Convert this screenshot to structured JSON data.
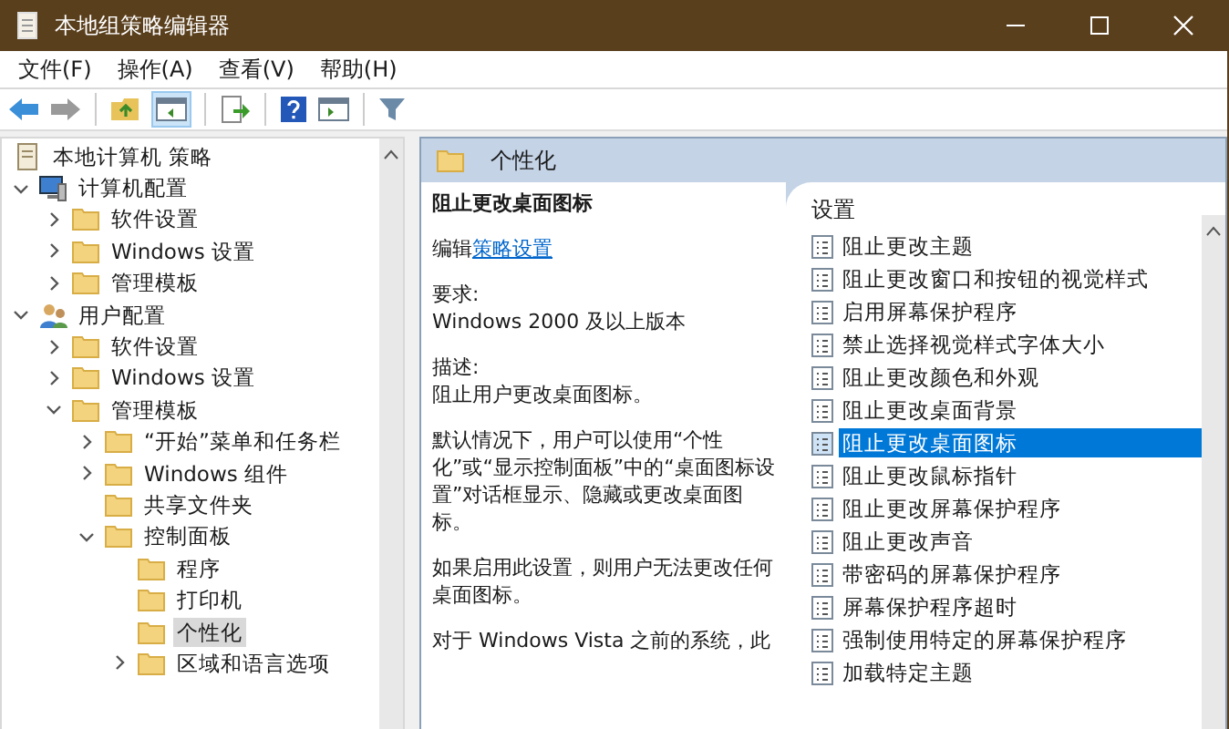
{
  "window": {
    "title": "本地组策略编辑器"
  },
  "menu": [
    "文件(F)",
    "操作(A)",
    "查看(V)",
    "帮助(H)"
  ],
  "tree": [
    {
      "label": "本地计算机 策略",
      "kind": "policy",
      "selected": false,
      "children": [
        {
          "label": "计算机配置",
          "kind": "computer",
          "selected": false,
          "expanded": true,
          "children": [
            {
              "label": "软件设置",
              "kind": "folder",
              "selected": false,
              "expanded": false
            },
            {
              "label": "Windows 设置",
              "kind": "folder",
              "selected": false,
              "expanded": false
            },
            {
              "label": "管理模板",
              "kind": "folder",
              "selected": false,
              "expanded": false
            }
          ]
        },
        {
          "label": "用户配置",
          "kind": "user",
          "selected": false,
          "expanded": true,
          "children": [
            {
              "label": "软件设置",
              "kind": "folder",
              "selected": false,
              "expanded": false
            },
            {
              "label": "Windows 设置",
              "kind": "folder",
              "selected": false,
              "expanded": false
            },
            {
              "label": "管理模板",
              "kind": "folder",
              "selected": false,
              "expanded": true,
              "children": [
                {
                  "label": "“开始”菜单和任务栏",
                  "kind": "folder",
                  "selected": false,
                  "expanded": false
                },
                {
                  "label": "Windows 组件",
                  "kind": "folder",
                  "selected": false,
                  "expanded": false
                },
                {
                  "label": "共享文件夹",
                  "kind": "folder",
                  "selected": false
                },
                {
                  "label": "控制面板",
                  "kind": "folder",
                  "selected": false,
                  "expanded": true,
                  "children": [
                    {
                      "label": "程序",
                      "kind": "folder",
                      "selected": false
                    },
                    {
                      "label": "打印机",
                      "kind": "folder",
                      "selected": false
                    },
                    {
                      "label": "个性化",
                      "kind": "folder",
                      "selected": true
                    },
                    {
                      "label": "区域和语言选项",
                      "kind": "folder",
                      "selected": false,
                      "expanded": false
                    }
                  ]
                }
              ]
            }
          ]
        }
      ]
    }
  ],
  "panel": {
    "title": "个性化"
  },
  "description": {
    "title": "阻止更改桌面图标",
    "edit_prefix": "编辑",
    "edit_link": "策略设置",
    "requirements_label": "要求:",
    "requirements": "Windows 2000 及以上版本",
    "description_label": "描述:",
    "paragraphs": [
      "阻止用户更改桌面图标。",
      "默认情况下，用户可以使用“个性化”或“显示控制面板”中的“桌面图标设置”对话框显示、隐藏或更改桌面图标。",
      "如果启用此设置，则用户无法更改任何桌面图标。",
      "对于 Windows Vista 之前的系统，此"
    ]
  },
  "settings": {
    "column": "设置",
    "items": [
      {
        "label": "阻止更改主题",
        "selected": false
      },
      {
        "label": "阻止更改窗口和按钮的视觉样式",
        "selected": false
      },
      {
        "label": "启用屏幕保护程序",
        "selected": false
      },
      {
        "label": "禁止选择视觉样式字体大小",
        "selected": false
      },
      {
        "label": "阻止更改颜色和外观",
        "selected": false
      },
      {
        "label": "阻止更改桌面背景",
        "selected": false
      },
      {
        "label": "阻止更改桌面图标",
        "selected": true
      },
      {
        "label": "阻止更改鼠标指针",
        "selected": false
      },
      {
        "label": "阻止更改屏幕保护程序",
        "selected": false
      },
      {
        "label": "阻止更改声音",
        "selected": false
      },
      {
        "label": "带密码的屏幕保护程序",
        "selected": false
      },
      {
        "label": "屏幕保护程序超时",
        "selected": false
      },
      {
        "label": "强制使用特定的屏幕保护程序",
        "selected": false
      },
      {
        "label": "加载特定主题",
        "selected": false
      }
    ]
  }
}
